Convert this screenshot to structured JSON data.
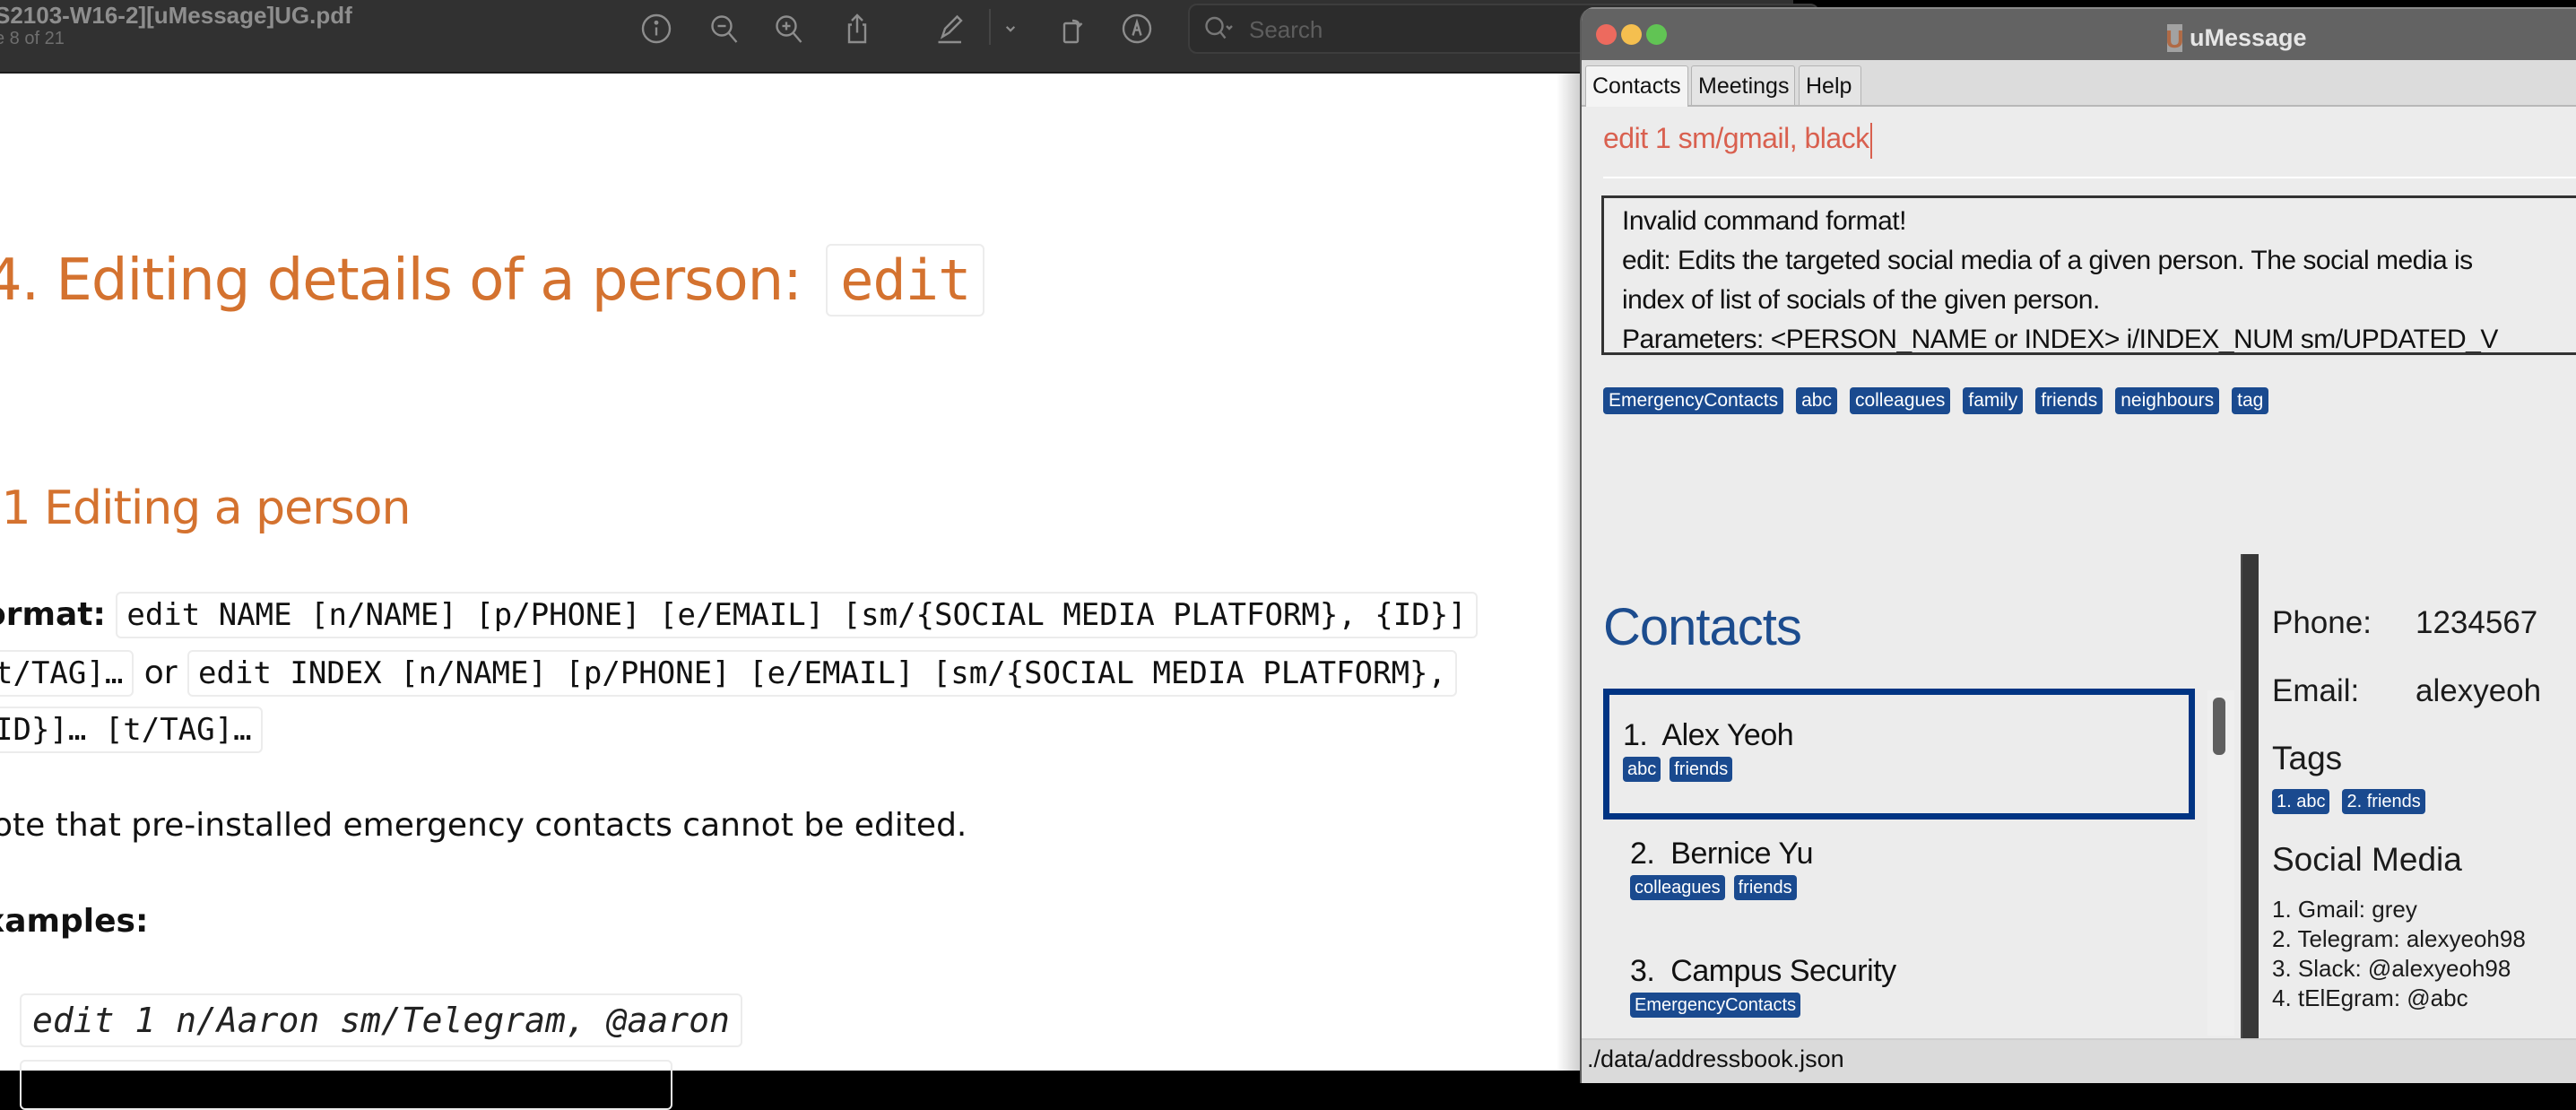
{
  "pdf_viewer": {
    "document_title": "S2103-W16-2][uMessage]UG.pdf",
    "page_indicator": "e 8 of 21",
    "toolbar": {
      "icons": [
        "info-icon",
        "zoom-out-icon",
        "zoom-in-icon",
        "share-icon",
        "highlight-pen-icon",
        "chevron-down-icon",
        "rotate-icon",
        "markup-icon"
      ],
      "search_placeholder": "Search"
    },
    "page": {
      "heading": "4. Editing details of a person:",
      "heading_code": "edit",
      "subheading": ".1 Editing a person",
      "format_label": "ormat:",
      "format_code_1": "edit NAME [n/NAME] [p/PHONE] [e/EMAIL] [sm/{SOCIAL MEDIA PLATFORM}, {ID}]",
      "format_code_1b": "t/TAG]…",
      "format_or": "or",
      "format_code_2": "edit INDEX [n/NAME] [p/PHONE] [e/EMAIL] [sm/{SOCIAL MEDIA PLATFORM},",
      "format_code_2b": "ID}]… [t/TAG]…",
      "note": "lote that pre-installed emergency contacts cannot be edited.",
      "examples_label": "xamples:",
      "example_1": "edit 1 n/Aaron sm/Telegram, @aaron",
      "example_2": ""
    }
  },
  "app": {
    "title": "uMessage",
    "logo_letter": "U",
    "tabs": [
      {
        "label": "Contacts",
        "active": true
      },
      {
        "label": "Meetings",
        "active": false
      },
      {
        "label": "Help",
        "active": false
      }
    ],
    "command_input": {
      "value": "edit 1 sm/gmail, black",
      "error_color": "#d9604f"
    },
    "result_lines": [
      "Invalid command format!",
      "edit: Edits the targeted social media of a given person. The social media is",
      "index of list of socials of the given person.",
      "Parameters: <PERSON_NAME or INDEX> i/INDEX_NUM sm/UPDATED_V"
    ],
    "all_tags": [
      "EmergencyContacts",
      "abc",
      "colleagues",
      "family",
      "friends",
      "neighbours",
      "tag"
    ],
    "tag_color": "#1a4a8f",
    "contacts_heading": "Contacts",
    "contacts": [
      {
        "index": "1.",
        "name": "Alex Yeoh",
        "tags": [
          "abc",
          "friends"
        ],
        "selected": true
      },
      {
        "index": "2.",
        "name": "Bernice Yu",
        "tags": [
          "colleagues",
          "friends"
        ],
        "selected": false
      },
      {
        "index": "3.",
        "name": "Campus Security",
        "tags": [
          "EmergencyContacts"
        ],
        "selected": false
      }
    ],
    "details": {
      "phone_label": "Phone:",
      "phone_value": "1234567",
      "email_label": "Email:",
      "email_value": "alexyeoh",
      "tags_heading": "Tags",
      "tags": [
        "1. abc",
        "2. friends"
      ],
      "social_heading": "Social Media",
      "socials": [
        "1. Gmail: grey",
        "2. Telegram: alexyeoh98",
        "3. Slack: @alexyeoh98",
        "4. tElEgram: @abc"
      ]
    },
    "status_bar": "./data/addressbook.json"
  }
}
